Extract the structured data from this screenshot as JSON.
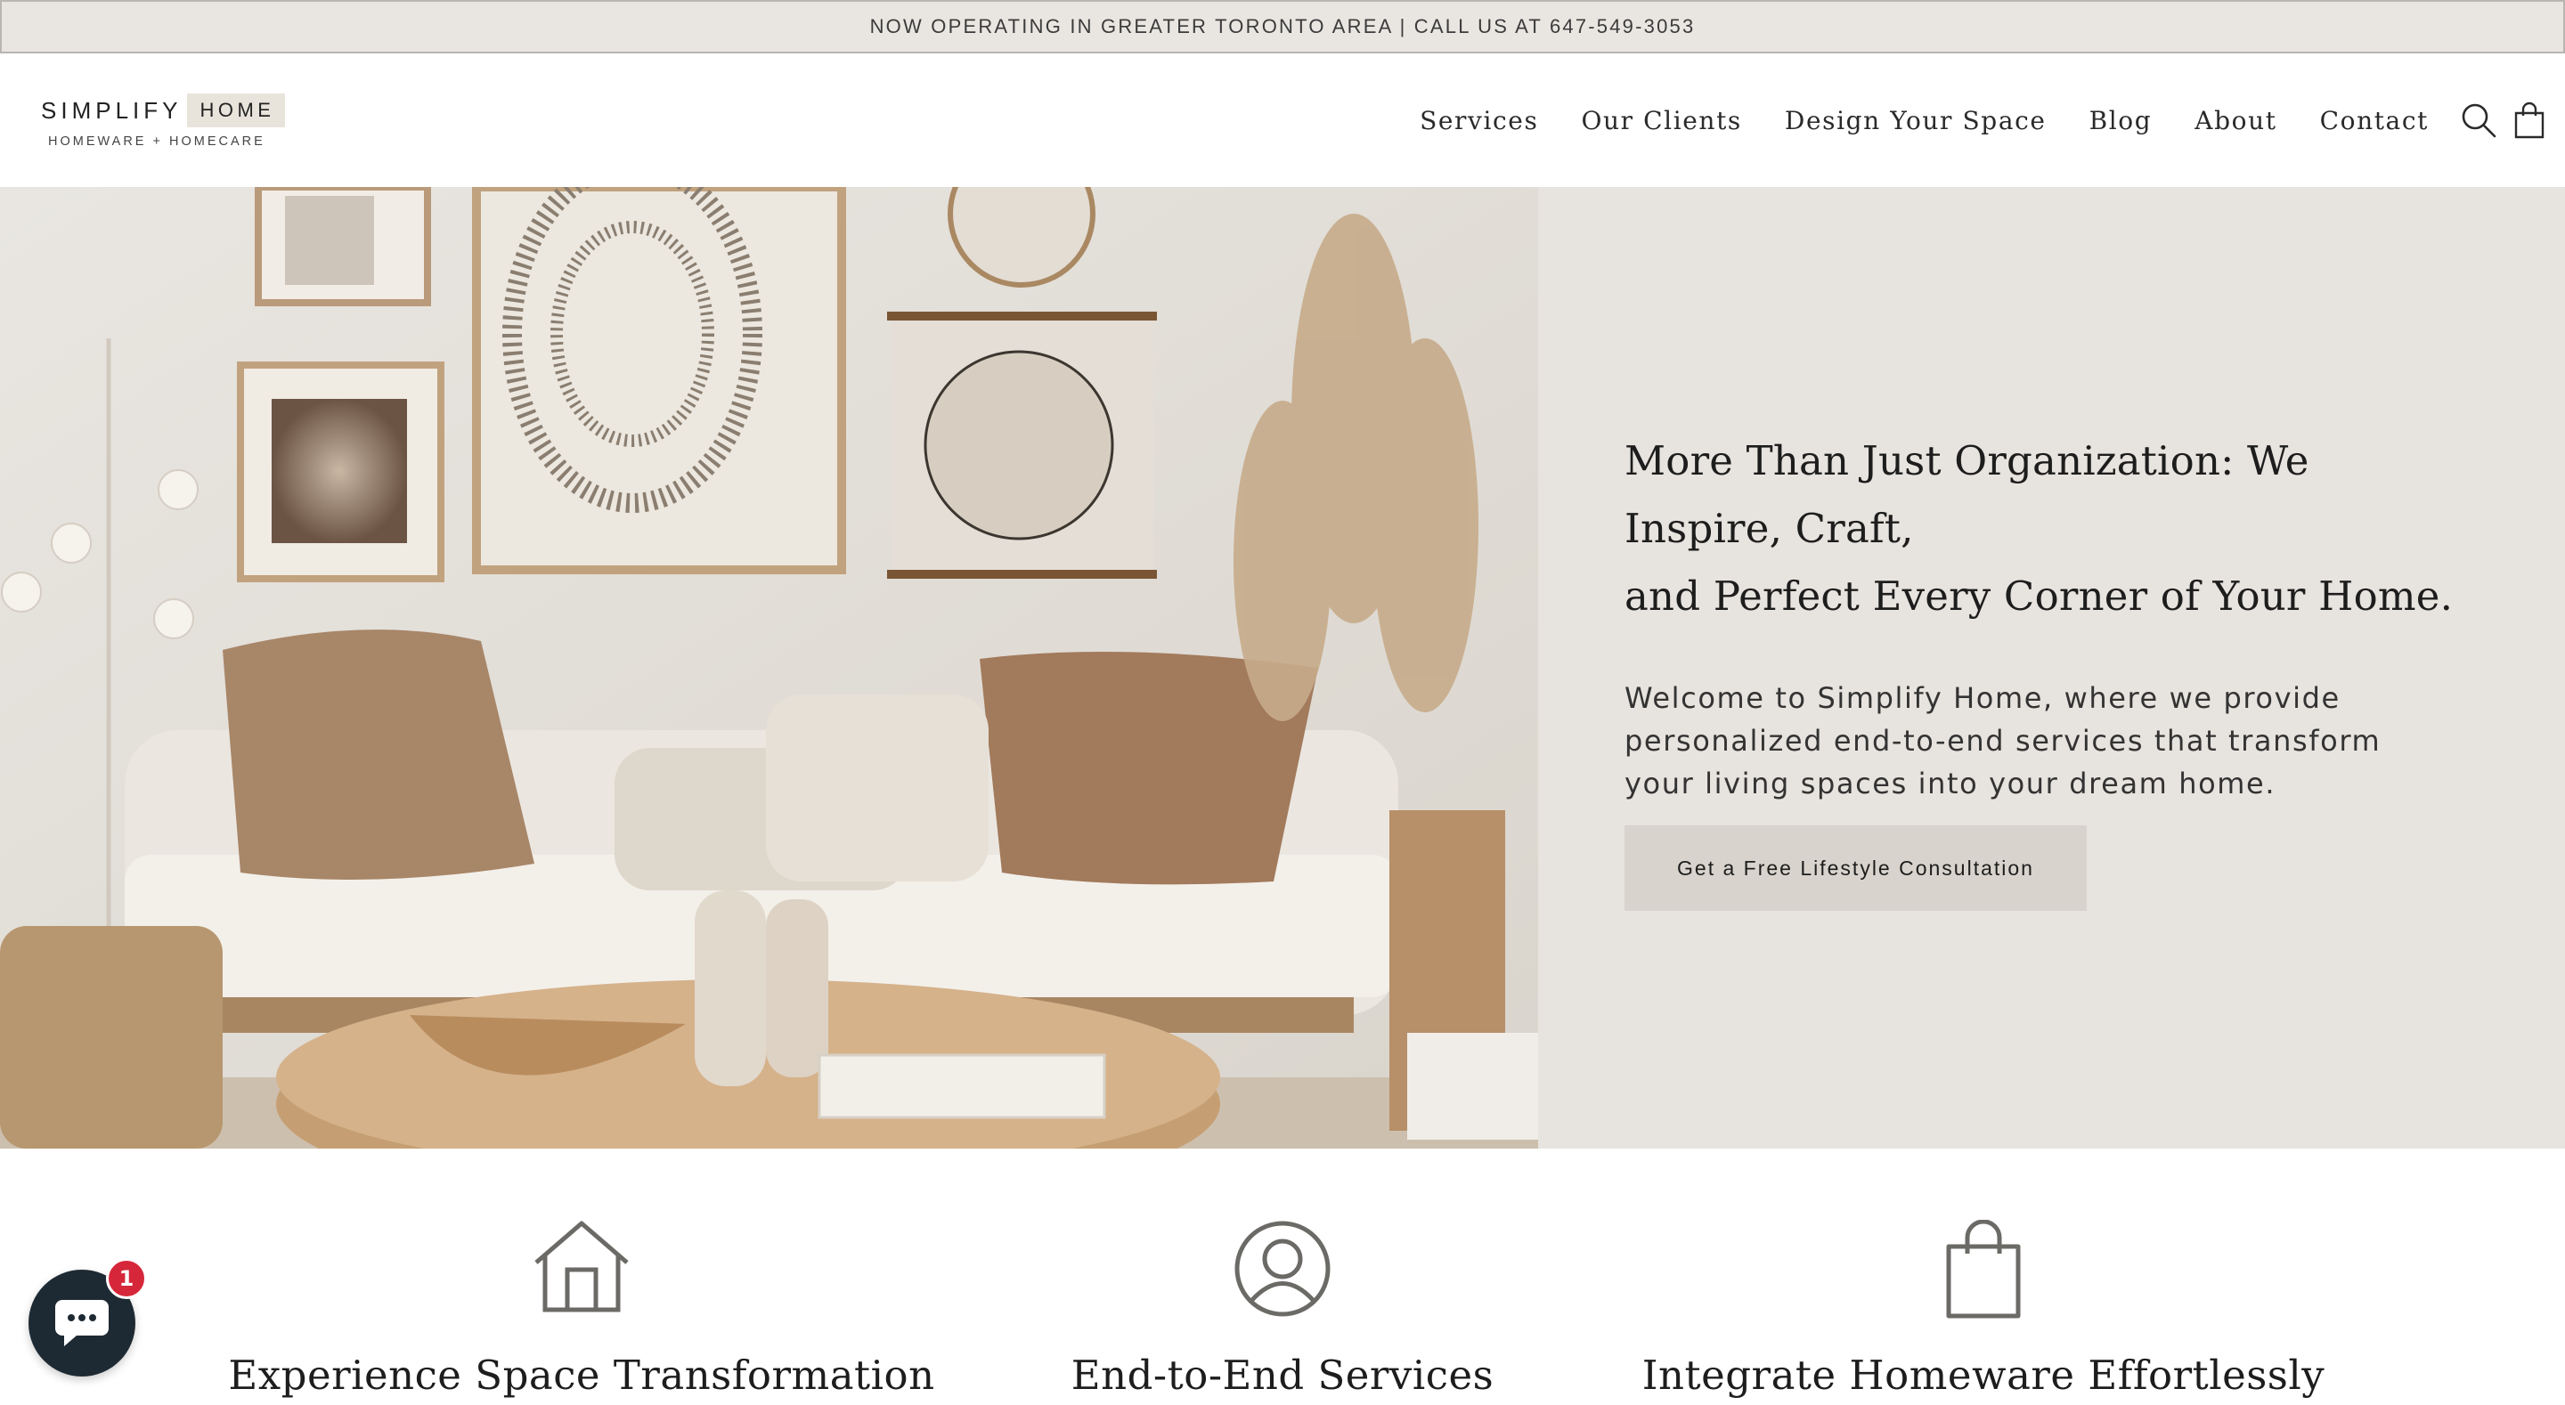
{
  "announcement": {
    "text": "NOW OPERATING IN GREATER TORONTO AREA | CALL US AT 647-549-3053"
  },
  "header": {
    "logo": {
      "word": "SIMPLIFY",
      "box": "HOME",
      "tagline": "HOMEWARE + HOMECARE"
    },
    "nav": [
      {
        "label": "Services"
      },
      {
        "label": "Our Clients"
      },
      {
        "label": "Design Your Space"
      },
      {
        "label": "Blog"
      },
      {
        "label": "About"
      },
      {
        "label": "Contact"
      }
    ],
    "icons": [
      "search-icon",
      "cart-icon"
    ]
  },
  "hero": {
    "image": "living-room-photo",
    "title_line1": "More Than Just Organization: We Inspire, Craft,",
    "title_line2": "and Perfect Every Corner of Your Home.",
    "body": "Welcome to Simplify Home, where we provide personalized end-to-end services that transform your living spaces into your dream home.",
    "cta": "Get a Free Lifestyle Consultation"
  },
  "features": [
    {
      "icon": "house-icon",
      "title": "Experience Space Transformation"
    },
    {
      "icon": "user-icon",
      "title": "End-to-End Services"
    },
    {
      "icon": "shopping-bag-icon",
      "title": "Integrate Homeware Effortlessly"
    }
  ],
  "chat": {
    "icon": "chat-icon",
    "badge": "1"
  },
  "colors": {
    "announcement_bg": "#e9e6e2",
    "hero_bg": "#e7e3de",
    "button_bg": "#d8d3cc",
    "icon_stroke": "#6b6a66",
    "chat_bg": "#1e2a33",
    "badge_bg": "#d6273a"
  }
}
